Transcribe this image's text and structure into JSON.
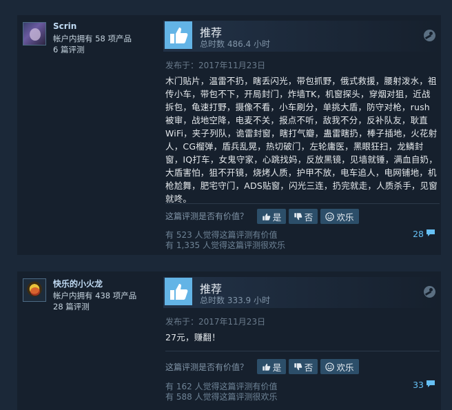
{
  "reviews": [
    {
      "author": {
        "name": "Scrin",
        "products_line": "帐户内拥有 58 项产品",
        "reviews_line": "6 篇评测"
      },
      "recommendation": "推荐",
      "hours": "总时数 486.4 小时",
      "posted": "发布于：2017年11月23日",
      "body": "木门贴片，温雷不扔，瞎丢闪光，带包抓野，俄式救援，腰射泼水，祖传小车，带包不下，开局封门，炸墙TK，机窗探头，穿烟对狙，近战拆包，龟速打野，摄像不看，小车刷分，单挑大盾，防守对枪，rush被审，战地空降，电麦不关，报点不听，敌我不分，反补队友，耿直WiFi，夹子列队，诡雷封窗，瞎打气瓣，蛊雷瞎扔，棒子插地，火花射人，CG榴弹，盾兵乱晃，热切破门，左轮庸医，黑眼狂扫，龙鳞封窗，IQ打车，女鬼守家，心跳找妈，反放黑镜，见墙就锤，满血自奶，大盾害怕，狙不开镜，烧烤人质，护甲不放，电车追人，电网铺地，机枪尬舞，肥宅守门，ADS贴窗，闪光三连，扔完就走，人质杀手，见窗就咚。",
      "helpful_question": "这篇评测是否有价值？",
      "buttons": {
        "yes": "是",
        "no": "否",
        "funny": "欢乐"
      },
      "helpful_stat": "有 523 人觉得这篇评测有价值",
      "funny_stat": "有 1,335 人觉得这篇评测很欢乐",
      "comment_count": "28"
    },
    {
      "author": {
        "name": "快乐的小火龙",
        "products_line": "帐户内拥有 438 项产品",
        "reviews_line": "28 篇评测"
      },
      "recommendation": "推荐",
      "hours": "总时数 333.9 小时",
      "posted": "发布于：2017年11月23日",
      "body": "27元，赚翻！",
      "helpful_question": "这篇评测是否有价值？",
      "buttons": {
        "yes": "是",
        "no": "否",
        "funny": "欢乐"
      },
      "helpful_stat": "有 162 人觉得这篇评测有价值",
      "funny_stat": "有 588 人觉得这篇评测很欢乐",
      "comment_count": "33"
    }
  ],
  "colors": {
    "page_bg": "#1b2838",
    "card_bg": "#16202d",
    "thumb_up": "#63b4e6",
    "button_bg": "#2c4e69",
    "link": "#66c0f4"
  }
}
